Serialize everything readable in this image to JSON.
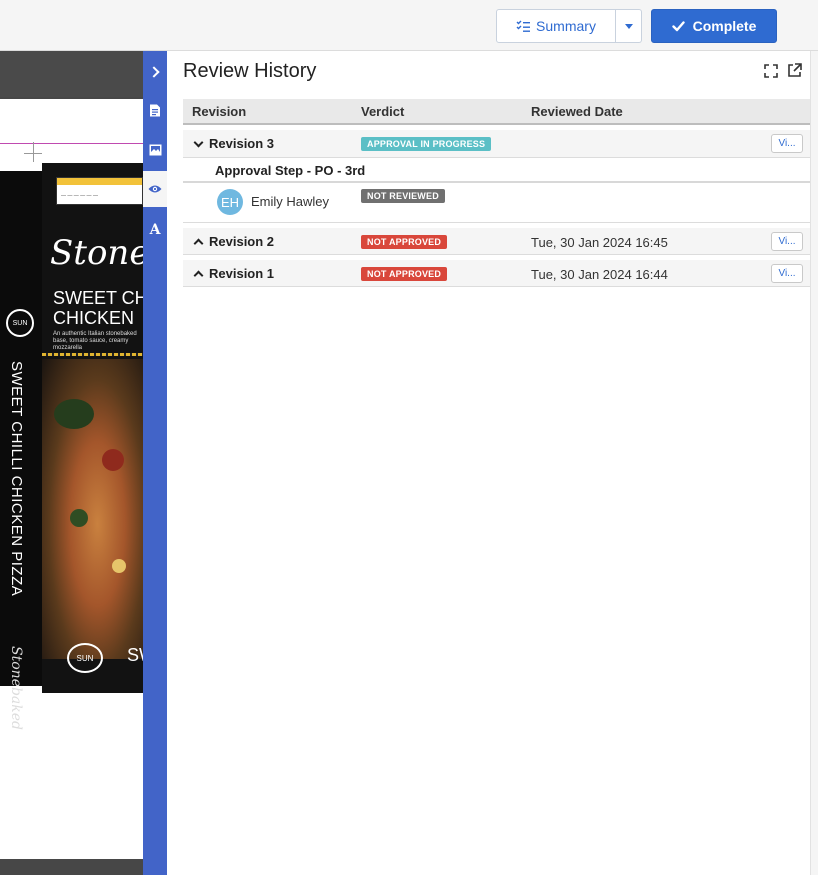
{
  "toolbar": {
    "summary_label": "Summary",
    "complete_label": "Complete"
  },
  "document": {
    "brand": "Stonebaked",
    "product_name": "SWEET CHILLI\nCHICKEN",
    "description": "An authentic Italian stonebaked base, tomato sauce, creamy mozzarella",
    "vertical_title": "SWEET CHILLI CHICKEN PIZZA",
    "sun_label": "SUN",
    "front_sw": "SW"
  },
  "rail": {
    "tools": [
      "collapse-panel",
      "notes",
      "gallery",
      "review-history",
      "text"
    ],
    "text_tool_label": "A"
  },
  "panel": {
    "title": "Review History",
    "columns": {
      "revision": "Revision",
      "verdict": "Verdict",
      "reviewed_date": "Reviewed Date"
    },
    "revisions": [
      {
        "label": "Revision 3",
        "expanded": true,
        "verdict": "APPROVAL IN PROGRESS",
        "date": "",
        "view_label": "Vi...",
        "step": "Approval Step - PO - 3rd",
        "reviewer": {
          "initials": "EH",
          "name": "Emily Hawley",
          "verdict": "NOT REVIEWED"
        }
      },
      {
        "label": "Revision 2",
        "expanded": false,
        "verdict": "NOT APPROVED",
        "date": "Tue, 30 Jan 2024 16:45",
        "view_label": "Vi..."
      },
      {
        "label": "Revision 1",
        "expanded": false,
        "verdict": "NOT APPROVED",
        "date": "Tue, 30 Jan 2024 16:44",
        "view_label": "Vi..."
      }
    ]
  },
  "colors": {
    "accent": "#2f6bd1",
    "rail": "#4264c8",
    "in_progress": "#5bbfc6",
    "not_approved": "#d9473b",
    "not_reviewed": "#707070",
    "avatar": "#6fb8e0"
  }
}
